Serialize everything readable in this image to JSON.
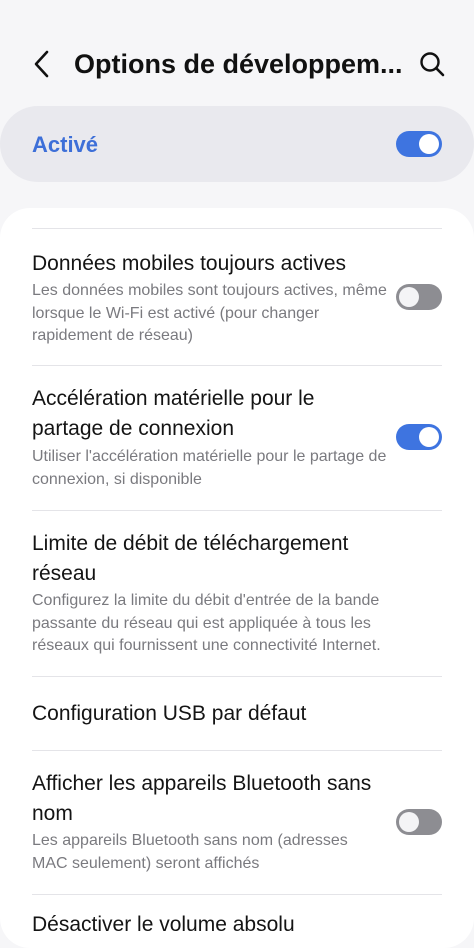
{
  "header": {
    "title": "Options de développem...",
    "back_icon": "chevron-left-icon",
    "search_icon": "search-icon"
  },
  "master_switch": {
    "label": "Activé",
    "on": true,
    "color": "#3d6fd8"
  },
  "settings": [
    {
      "title": "Données mobiles toujours actives",
      "description": "Les données mobiles sont toujours actives, même lorsque le Wi-Fi est activé (pour changer rapidement de réseau)",
      "toggle": "off"
    },
    {
      "title": "Accélération matérielle pour le partage de connexion",
      "description": "Utiliser l'accélération matérielle pour le partage de connexion, si disponible",
      "toggle": "on"
    },
    {
      "title": "Limite de débit de téléchargement réseau",
      "description": "Configurez la limite du débit d'entrée de la bande passante du réseau qui est appliquée à tous les réseaux qui fournissent une connectivité Internet."
    },
    {
      "title": "Configuration USB par défaut"
    },
    {
      "title": "Afficher les appareils Bluetooth sans nom",
      "description": "Les appareils Bluetooth sans nom (adresses MAC seulement) seront affichés",
      "toggle": "off"
    },
    {
      "title": "Désactiver le volume absolu"
    }
  ],
  "colors": {
    "accent": "#3e74e0",
    "toggle_off": "#8d8d92",
    "background": "#f6f6f8",
    "card": "#ffffff"
  }
}
